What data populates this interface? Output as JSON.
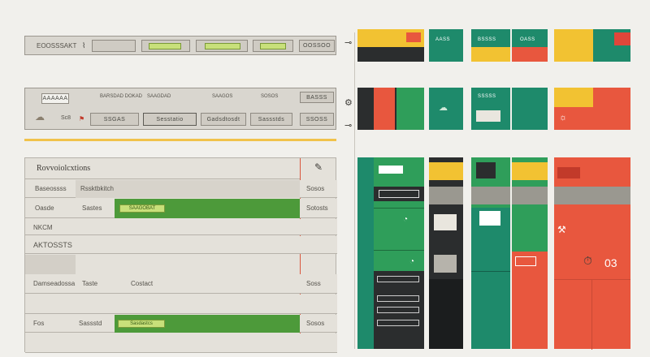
{
  "toolbar_top": {
    "left_label": "EOOSSSAKT",
    "cells": [
      "",
      "",
      "",
      "",
      "OOSSOO"
    ]
  },
  "toolbar_second": {
    "badge": "AAAAAA",
    "label_a": "Sc8",
    "cells_top": [
      "BARSDAD DOKAD",
      "SAAGDAD",
      "SAAGOS",
      "SOSOS",
      "BASSS"
    ],
    "cells_bottom": [
      "SSGAS",
      "Sesstatio",
      "Gadsdtosdt",
      "Sassstds",
      "SSOSS"
    ]
  },
  "form": {
    "title": "Rovvoiolcxtions",
    "rows": [
      {
        "label": "Baseossss",
        "value": "Rssktbkitch",
        "side": "Sosos"
      },
      {
        "label": "Oasde",
        "value": "Sastes",
        "side": "Sotosts",
        "highlight": "SAAGOBAT"
      },
      {
        "label": "NKCM",
        "value": "",
        "side": ""
      },
      {
        "label": "AKTOSSTS",
        "value": "",
        "side": ""
      },
      {
        "label": "Damseadossa",
        "value": "Taste",
        "extra": "Costact",
        "side": "Soss"
      },
      {
        "label": "",
        "value": "",
        "side": ""
      },
      {
        "label": "Fos",
        "value": "Sassstd",
        "side": "Sosos",
        "highlight": "Sasdastcs"
      },
      {
        "label": "",
        "value": "",
        "side": ""
      }
    ]
  },
  "panels": {
    "top_row": [
      "AASS",
      "BSSSS",
      "OASS",
      ""
    ],
    "second_row": [
      "",
      "SSSSS",
      "",
      ""
    ],
    "big_number": "03",
    "colors": {
      "green": "#2f9e5a",
      "teal": "#1e8a6b",
      "dark": "#2b2d2e",
      "orange": "#e8573e",
      "yellow": "#f2c232",
      "red": "#e0463a"
    }
  }
}
